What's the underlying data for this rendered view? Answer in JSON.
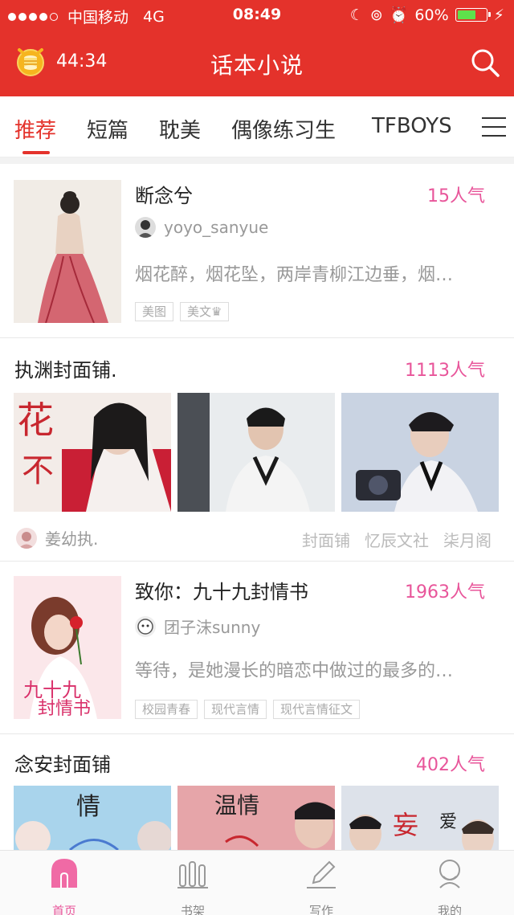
{
  "status_bar": {
    "carrier": "中国移动",
    "network": "4G",
    "time": "08:49",
    "battery": "60%"
  },
  "header": {
    "timer": "44:34",
    "title": "话本小说"
  },
  "tabs": [
    {
      "label": "推荐"
    },
    {
      "label": "短篇"
    },
    {
      "label": "耽美"
    },
    {
      "label": "偶像练习生"
    },
    {
      "label": "TFBOYS"
    }
  ],
  "books": [
    {
      "title": "断念兮",
      "popularity": "15人气",
      "author": "yoyo_sanyue",
      "summary": "烟花醉，烟花坠，两岸青柳江边垂，烟…",
      "tags": [
        "美图",
        "美文♛"
      ]
    },
    {
      "title": "致你：九十九封情书",
      "popularity": "1963人气",
      "author": "团子沫sunny",
      "summary": "等待，是她漫长的暗恋中做过的最多的…",
      "tags": [
        "校园青春",
        "现代言情",
        "现代言情征文"
      ]
    }
  ],
  "shops": [
    {
      "name": "执渊封面铺.",
      "popularity": "1113人气",
      "owner": "姜幼执.",
      "categories": [
        "封面铺",
        "忆辰文社",
        "柒月阁"
      ]
    },
    {
      "name": "念安封面铺",
      "popularity": "402人气"
    }
  ],
  "bottom_nav": [
    {
      "label": "首页"
    },
    {
      "label": "书架"
    },
    {
      "label": "写作"
    },
    {
      "label": "我的"
    }
  ],
  "colors": {
    "brand_red": "#e4322b",
    "popularity_pink": "#e8559a"
  },
  "icons": [
    "alarm-clock-icon",
    "search-icon",
    "menu-icon",
    "home-icon",
    "bookshelf-icon",
    "pen-icon",
    "profile-icon"
  ]
}
